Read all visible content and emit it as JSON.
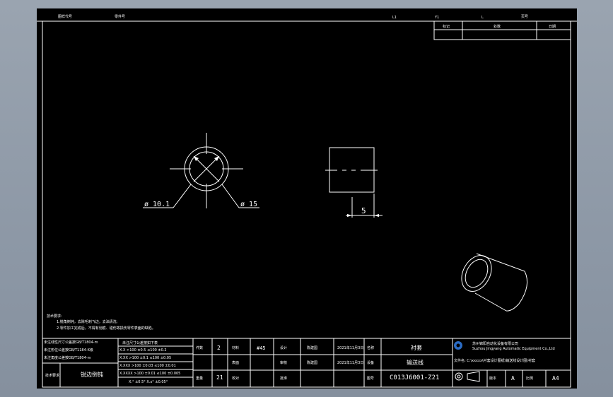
{
  "top_strip": {
    "label_1": "图样代号",
    "label_2": "零件号",
    "mark_l1": "L1",
    "mark_y1": "Y1",
    "mark_l": "L",
    "mark_page": "页号"
  },
  "revision_table": {
    "headers": [
      "标记",
      "处数",
      "日期"
    ]
  },
  "part_views": {
    "dim_inner_diameter": "ø 10.1",
    "dim_outer_diameter": "ø 15",
    "dim_length": "5"
  },
  "notes": {
    "title": "技术要求:",
    "line_1": "1.锐角倒钝，去除毛刺飞边，去油清洗;",
    "line_2": "2.零件加工完成后，不得有划痕、碰伤等损伤零件表面的缺陷。"
  },
  "tolerance_table": {
    "header": "未注尺寸公差按如下表",
    "row_labels": [
      "未注线性尺寸公差按GB/T1804-m",
      "未注形位公差按GB/T1184-K级",
      "未注角度公差按GB/T1804-m"
    ],
    "rows": [
      "X.X   >100 ±0.5   ≤100 ±0.2",
      "X.XX   >100 ±0.1   ≤100 ±0.05",
      "X.XXX   >100 ±0.03   ≤100 ±0.01",
      "X.XXXX  >100 ±0.01   ≤100 ±0.005",
      "X.°  ±0.5°     X.x°  ±0.05°"
    ],
    "tech_label": "技术要求",
    "tech_value": "锐边倒钝"
  },
  "title_block": {
    "qty_label": "件数",
    "qty": "2",
    "material_label": "材料",
    "material": "#45",
    "designer_label": "设计",
    "designer": "陈建国",
    "design_date": "2021年11月3日",
    "name_label": "名称",
    "name": "衬套",
    "weight_label": "重量",
    "weight": "21",
    "surface_label": "表面",
    "checker_label": "审核",
    "checker": "陈建国",
    "check_date": "2021年11月3日",
    "equipment_label": "设备",
    "equipment": "输送线",
    "review_label": "校对",
    "approve_label": "批准",
    "drawing_no_label": "图号",
    "drawing_no": "C013J6001-Z21",
    "company_cn": "苏州锦阳自动化设备有限公司",
    "company_en": "Suzhou Jingyang Automatic Equipment Co.,Ltd",
    "file_path": "文件名: C:\\xxxxx\\衬套设计图纸\\输送线设计图\\衬套",
    "version_label": "版本",
    "version": "A",
    "scale_label": "比例",
    "sheet_size": "A4"
  }
}
